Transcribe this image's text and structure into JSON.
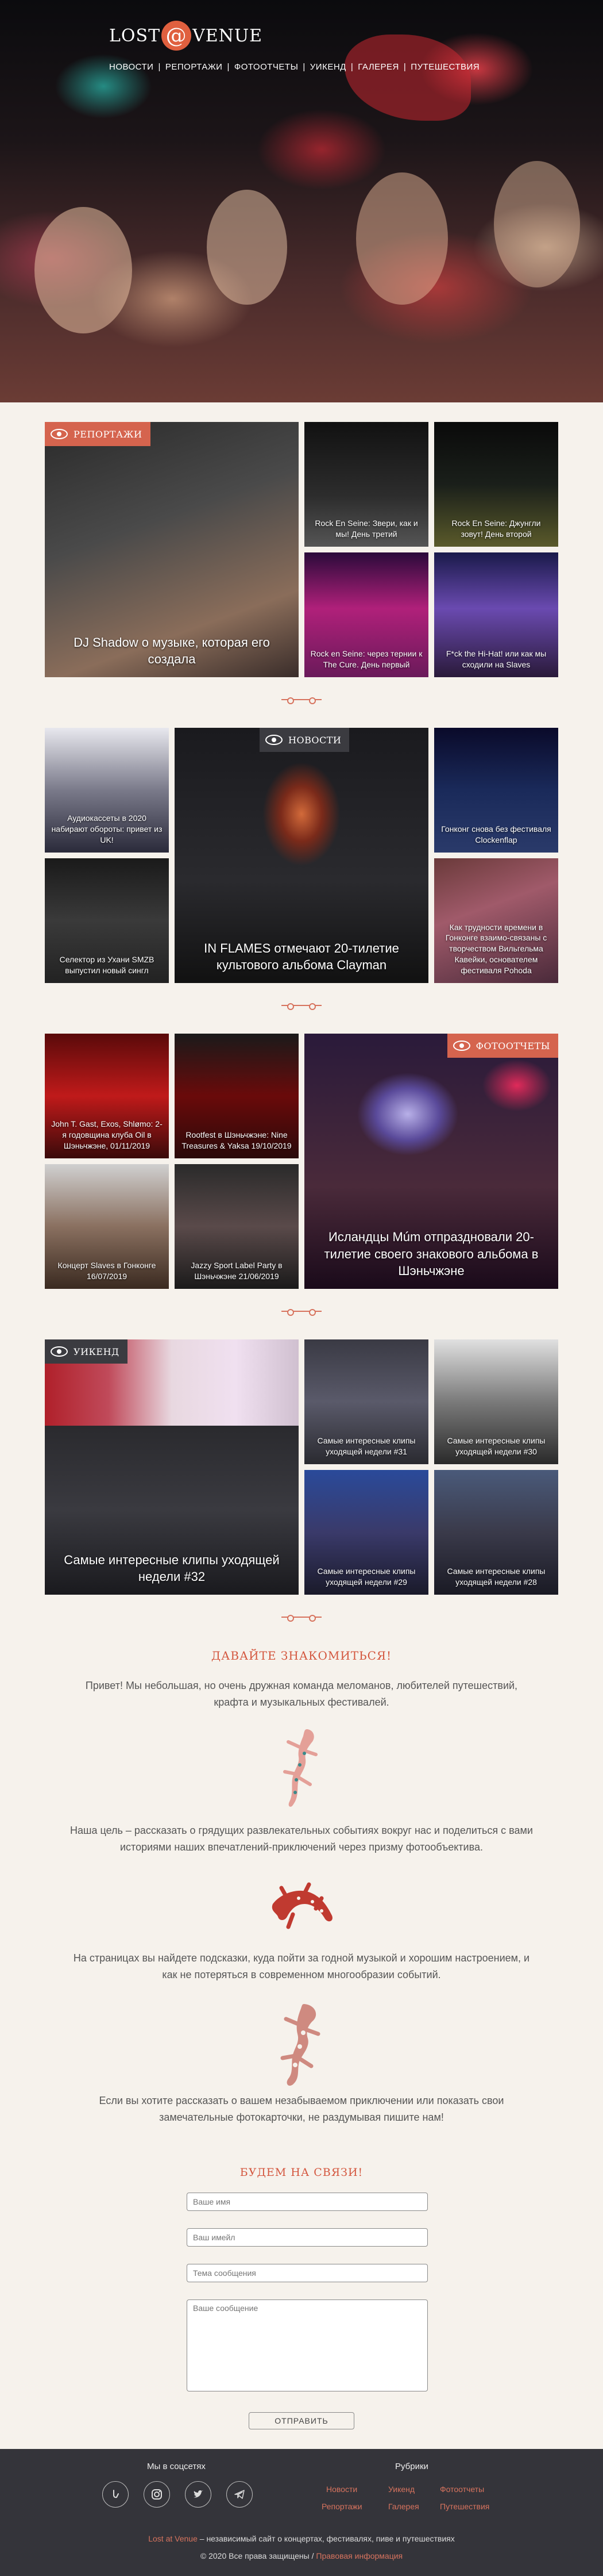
{
  "site": {
    "logo_left": "LOST",
    "logo_at": "@",
    "logo_right": "VENUE"
  },
  "nav": {
    "items": [
      "НОВОСТИ",
      "РЕПОРТАЖИ",
      "ФОТООТЧЕТЫ",
      "УИКЕНД",
      "ГАЛЕРЕЯ",
      "ПУТЕШЕСТВИЯ"
    ],
    "separator": "|"
  },
  "reports": {
    "badge": "РЕПОРТАЖИ",
    "main": "DJ Shadow о музыке, которая его создала",
    "tiles": [
      "Rock En Seine: Звери, как и мы! День третий",
      "Rock En Seine: Джунгли зовут! День второй",
      "Rock en Seine: через тернии к The Cure. День первый",
      "F*ck the Hi-Hat! или как мы сходили на Slaves"
    ]
  },
  "news": {
    "badge": "НОВОСТИ",
    "main": "IN FLAMES отмечают 20-тилетие культового альбома Clayman",
    "tiles": [
      "Аудиокассеты в 2020 набирают обороты: привет из UK!",
      "Селектор из Ухани SMZB выпустил новый сингл",
      "Гонконг снова без фестиваля Clockenflap",
      "Как трудности времени в Гонконге взаимо-связаны с творчеством Вильгельма Кавейки, основателем фестиваля Pohoda"
    ]
  },
  "photo": {
    "badge": "ФОТООТЧЕТЫ",
    "main": "Исландцы Múm отпраздновали 20-тилетие своего знакового альбома в Шэньчжэне",
    "tiles": [
      "John T. Gast, Exos, Shlømo: 2-я годовщина клуба Oil в Шэньчжэне, 01/11/2019",
      "Rootfest в Шэньчжэне: Nine Treasures & Yaksa 19/10/2019",
      "Концерт Slaves в Гонконге 16/07/2019",
      "Jazzy Sport Label Party в Шэньчжэне 21/06/2019"
    ]
  },
  "weekend": {
    "badge": "УИКЕНД",
    "main": "Самые интересные клипы уходящей недели #32",
    "tiles": [
      "Самые интересные клипы уходящей недели #31",
      "Самые интересные клипы уходящей недели #30",
      "Самые интересные клипы уходящей недели #29",
      "Самые интересные клипы уходящей недели #28"
    ]
  },
  "about": {
    "title": "ДАВАЙТЕ ЗНАКОМИТЬСЯ!",
    "p1": "Привет! Мы небольшая, но очень дружная команда меломанов, любителей путешествий, крафта и музыкальных фестивалей.",
    "p2": "Наша цель – рассказать о грядущих развлекательных событиях вокруг нас и поделиться с вами историями наших впечатлений-приключений через призму фотообъектива.",
    "p3": "На страницах вы найдете подсказки, куда пойти за годной музыкой и хорошим настроением, и как не потеряться в современном многообразии событий.",
    "p4": "Если вы хотите рассказать о вашем незабываемом приключении или показать свои замечательные фотокарточки, не раздумывая пишите нам!"
  },
  "contact": {
    "title": "БУДЕМ НА СВЯЗИ!",
    "name_placeholder": "Ваше имя",
    "email_placeholder": "Ваш имейл",
    "subject_placeholder": "Тема сообщения",
    "message_placeholder": "Ваше сообщение",
    "submit": "ОТПРАВИТЬ"
  },
  "footer": {
    "social_title": "Мы в соцсетях",
    "rubrics_title": "Рубрики",
    "rubrics": [
      "Новости",
      "Уикенд",
      "Фотоотчеты",
      "Репортажи",
      "Галерея",
      "Путешествия"
    ],
    "brand": "Lost at Venue",
    "tagline": " – независимый сайт о концертах, фестивалях, пиве и путешествиях",
    "copyright": "© 2020 Все права защищены / ",
    "privacy": "Правовая информация"
  },
  "colors": {
    "accent": "#d4573f",
    "background": "#f6f2ec",
    "footer": "#34343a"
  }
}
